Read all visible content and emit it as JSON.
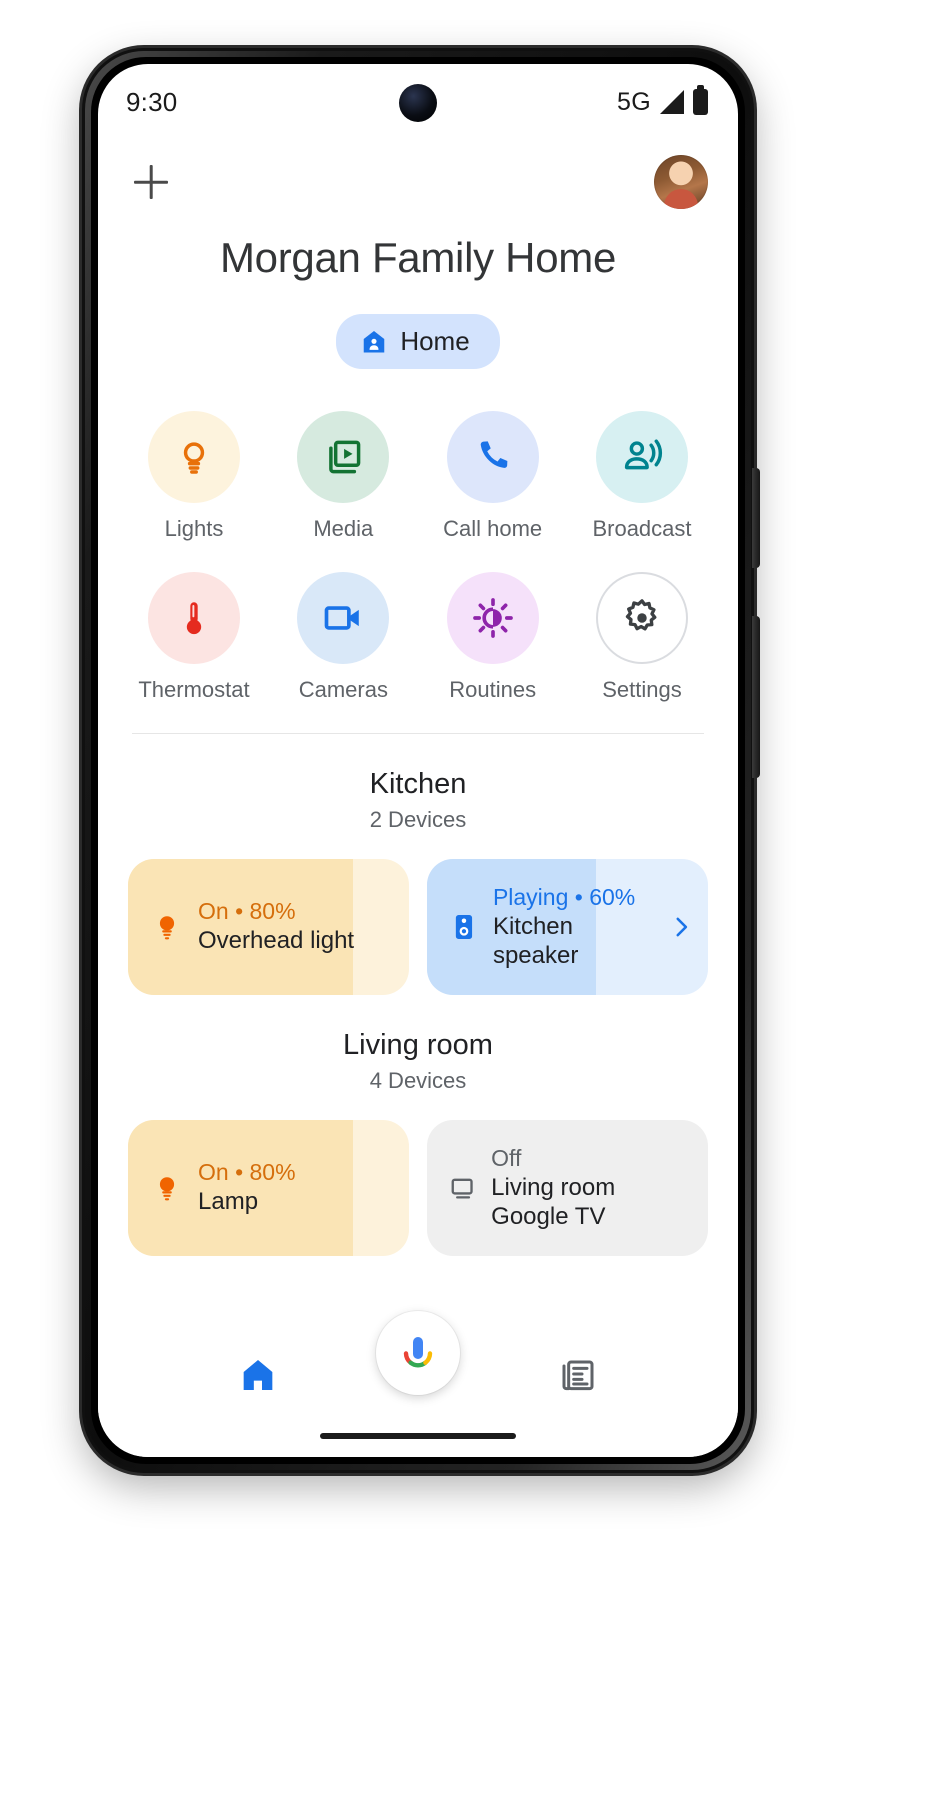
{
  "status_bar": {
    "time": "9:30",
    "network": "5G",
    "signal_icon": "signal-bars-icon",
    "battery_icon": "battery-full-icon"
  },
  "header": {
    "add_icon": "plus-icon",
    "avatar_icon": "user-avatar",
    "title": "Morgan Family Home"
  },
  "home_chip": {
    "label": "Home",
    "icon": "home-person-icon",
    "bg_color": "#D3E3FD",
    "icon_color": "#1A73E8"
  },
  "quick_actions": [
    {
      "label": "Lights",
      "icon": "lightbulb-icon",
      "bg": "#FDF3DD",
      "fg": "#E8710A"
    },
    {
      "label": "Media",
      "icon": "media-play-icon",
      "bg": "#D6EADF",
      "fg": "#137333"
    },
    {
      "label": "Call home",
      "icon": "phone-icon",
      "bg": "#DDE6FB",
      "fg": "#1A73E8"
    },
    {
      "label": "Broadcast",
      "icon": "broadcast-icon",
      "bg": "#D7F0F2",
      "fg": "#00838F"
    },
    {
      "label": "Thermostat",
      "icon": "thermometer-icon",
      "bg": "#FCE4E2",
      "fg": "#E52B1F"
    },
    {
      "label": "Cameras",
      "icon": "camcorder-icon",
      "bg": "#D9E8F8",
      "fg": "#1A73E8"
    },
    {
      "label": "Routines",
      "icon": "routines-sun-icon",
      "bg": "#F5E1FA",
      "fg": "#8E24AA"
    },
    {
      "label": "Settings",
      "icon": "gear-icon",
      "bg": "#FFFFFF",
      "fg": "#3C4043"
    }
  ],
  "rooms": [
    {
      "name": "Kitchen",
      "device_count": "2 Devices",
      "devices": [
        {
          "status": "On • 80%",
          "name": "Overhead light",
          "icon": "lightbulb-icon",
          "fill_percent": 80,
          "fill_color": "#FAE4B5",
          "track_color": "#FDF2DB",
          "status_color": "#D56E0C",
          "icon_color": "#F06400",
          "has_chevron": false
        },
        {
          "status": "Playing • 60%",
          "name": "Kitchen speaker",
          "icon": "speaker-icon",
          "fill_percent": 60,
          "fill_color": "#C5DEFA",
          "track_color": "#E3EFFD",
          "status_color": "#1A73E8",
          "icon_color": "#1A73E8",
          "has_chevron": true,
          "chevron_icon": "chevron-right-icon"
        }
      ]
    },
    {
      "name": "Living room",
      "device_count": "4 Devices",
      "devices": [
        {
          "status": "On • 80%",
          "name": "Lamp",
          "icon": "lightbulb-icon",
          "fill_percent": 80,
          "fill_color": "#FAE4B5",
          "track_color": "#FDF2DB",
          "status_color": "#D56E0C",
          "icon_color": "#F06400",
          "has_chevron": false
        },
        {
          "status": "Off",
          "name": "Living room Google TV",
          "icon": "tv-icon",
          "fill_percent": 0,
          "fill_color": "#EFEFEF",
          "track_color": "#EFEFEF",
          "status_color": "#5F6368",
          "icon_color": "#5F6368",
          "has_chevron": false
        }
      ]
    }
  ],
  "bottom_nav": {
    "items": [
      {
        "icon": "home-filled-icon",
        "active": true,
        "color": "#1A73E8"
      },
      {
        "icon": "feed-icon",
        "active": false,
        "color": "#5F6368"
      }
    ],
    "assistant_fab_icon": "google-assistant-mic-icon"
  }
}
